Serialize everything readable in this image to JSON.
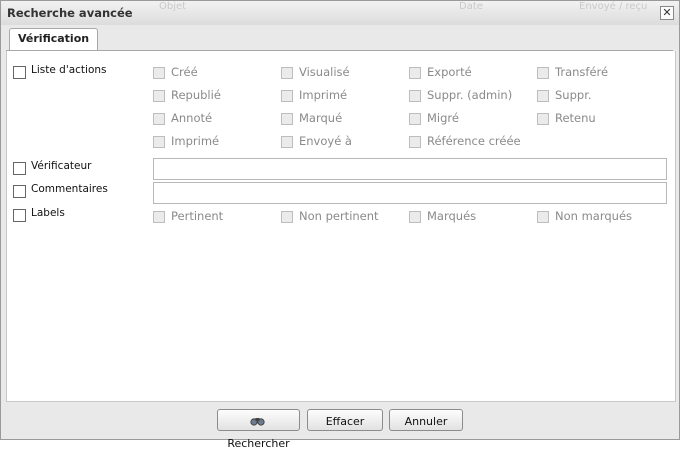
{
  "dialog": {
    "title": "Recherche avancée"
  },
  "tabs": [
    {
      "label": "Vérification"
    }
  ],
  "rows": {
    "actions": {
      "label": "Liste d'actions"
    },
    "verificateur": {
      "label": "Vérificateur",
      "value": ""
    },
    "commentaires": {
      "label": "Commentaires",
      "value": ""
    },
    "labels": {
      "label": "Labels"
    }
  },
  "actions_options": [
    "Créé",
    "Visualisé",
    "Exporté",
    "Transféré",
    "Republié",
    "Imprimé",
    "Suppr. (admin)",
    "Suppr.",
    "Annoté",
    "Marqué",
    "Migré",
    "Retenu",
    "Imprimé",
    "Envoyé à",
    "Référence créée"
  ],
  "labels_options": [
    "Pertinent",
    "Non pertinent",
    "Marqués",
    "Non marqués"
  ],
  "buttons": {
    "search": "Rechercher",
    "clear": "Effacer",
    "cancel": "Annuler"
  }
}
